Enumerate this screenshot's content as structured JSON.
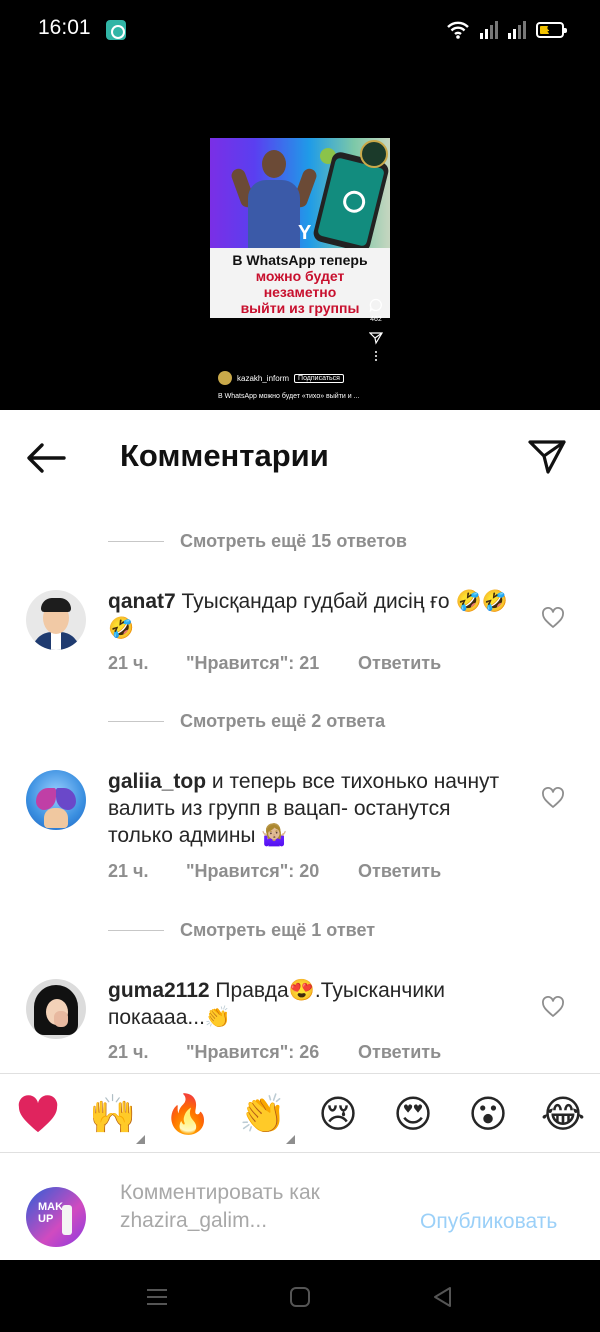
{
  "status_bar": {
    "time": "16:01",
    "battery": "9",
    "icons": [
      "notification-app-icon",
      "wifi-icon",
      "signal-icon",
      "signal-icon",
      "battery-icon"
    ]
  },
  "reel": {
    "caption_line1": "В WhatsApp теперь",
    "caption_line2": "можно будет",
    "caption_line3": "незаметно",
    "caption_line4": "выйти из группы",
    "comment_count": "462",
    "author": "kazakh_inform",
    "follow_label": "Подписаться",
    "description": "В WhatsApp можно будет «тихо» выйти и ..."
  },
  "header": {
    "title": "Комментарии",
    "icons": [
      "arrow-left-icon",
      "paper-plane-icon"
    ]
  },
  "comments": [
    {
      "view_replies": "Смотреть ещё 15 ответов",
      "username": "qanat7",
      "text": "Туысқандар гудбай дисің ғо 🤣🤣🤣",
      "time": "21 ч.",
      "likes": "\"Нравится\": 21",
      "reply_label": "Ответить"
    },
    {
      "view_replies": "Смотреть ещё 2 ответа",
      "username": "galiia_top",
      "text": "и теперь  все тихонько начнут валить из групп в вацап- останутся только админы 🤷🏼‍♀️",
      "time": "21 ч.",
      "likes": "\"Нравится\": 20",
      "reply_label": "Ответить"
    },
    {
      "view_replies": "Смотреть ещё 1 ответ",
      "username": "guma2112",
      "text": "Правда😍.Туысканчики покаааа...👏",
      "time": "21 ч.",
      "likes": "\"Нравится\": 26",
      "reply_label": "Ответить"
    }
  ],
  "quick_emojis": [
    "❤️",
    "🙌",
    "🔥",
    "👏",
    "😢",
    "😍",
    "😮",
    "😂"
  ],
  "composer": {
    "placeholder": "Комментировать как zhazira_galim...",
    "post_label": "Опубликовать"
  },
  "colors": {
    "accent": "#0095f6",
    "post_disabled": "#9bd0f8",
    "secondary_text": "#8e8e8e",
    "heart_red": "#e0245e"
  }
}
